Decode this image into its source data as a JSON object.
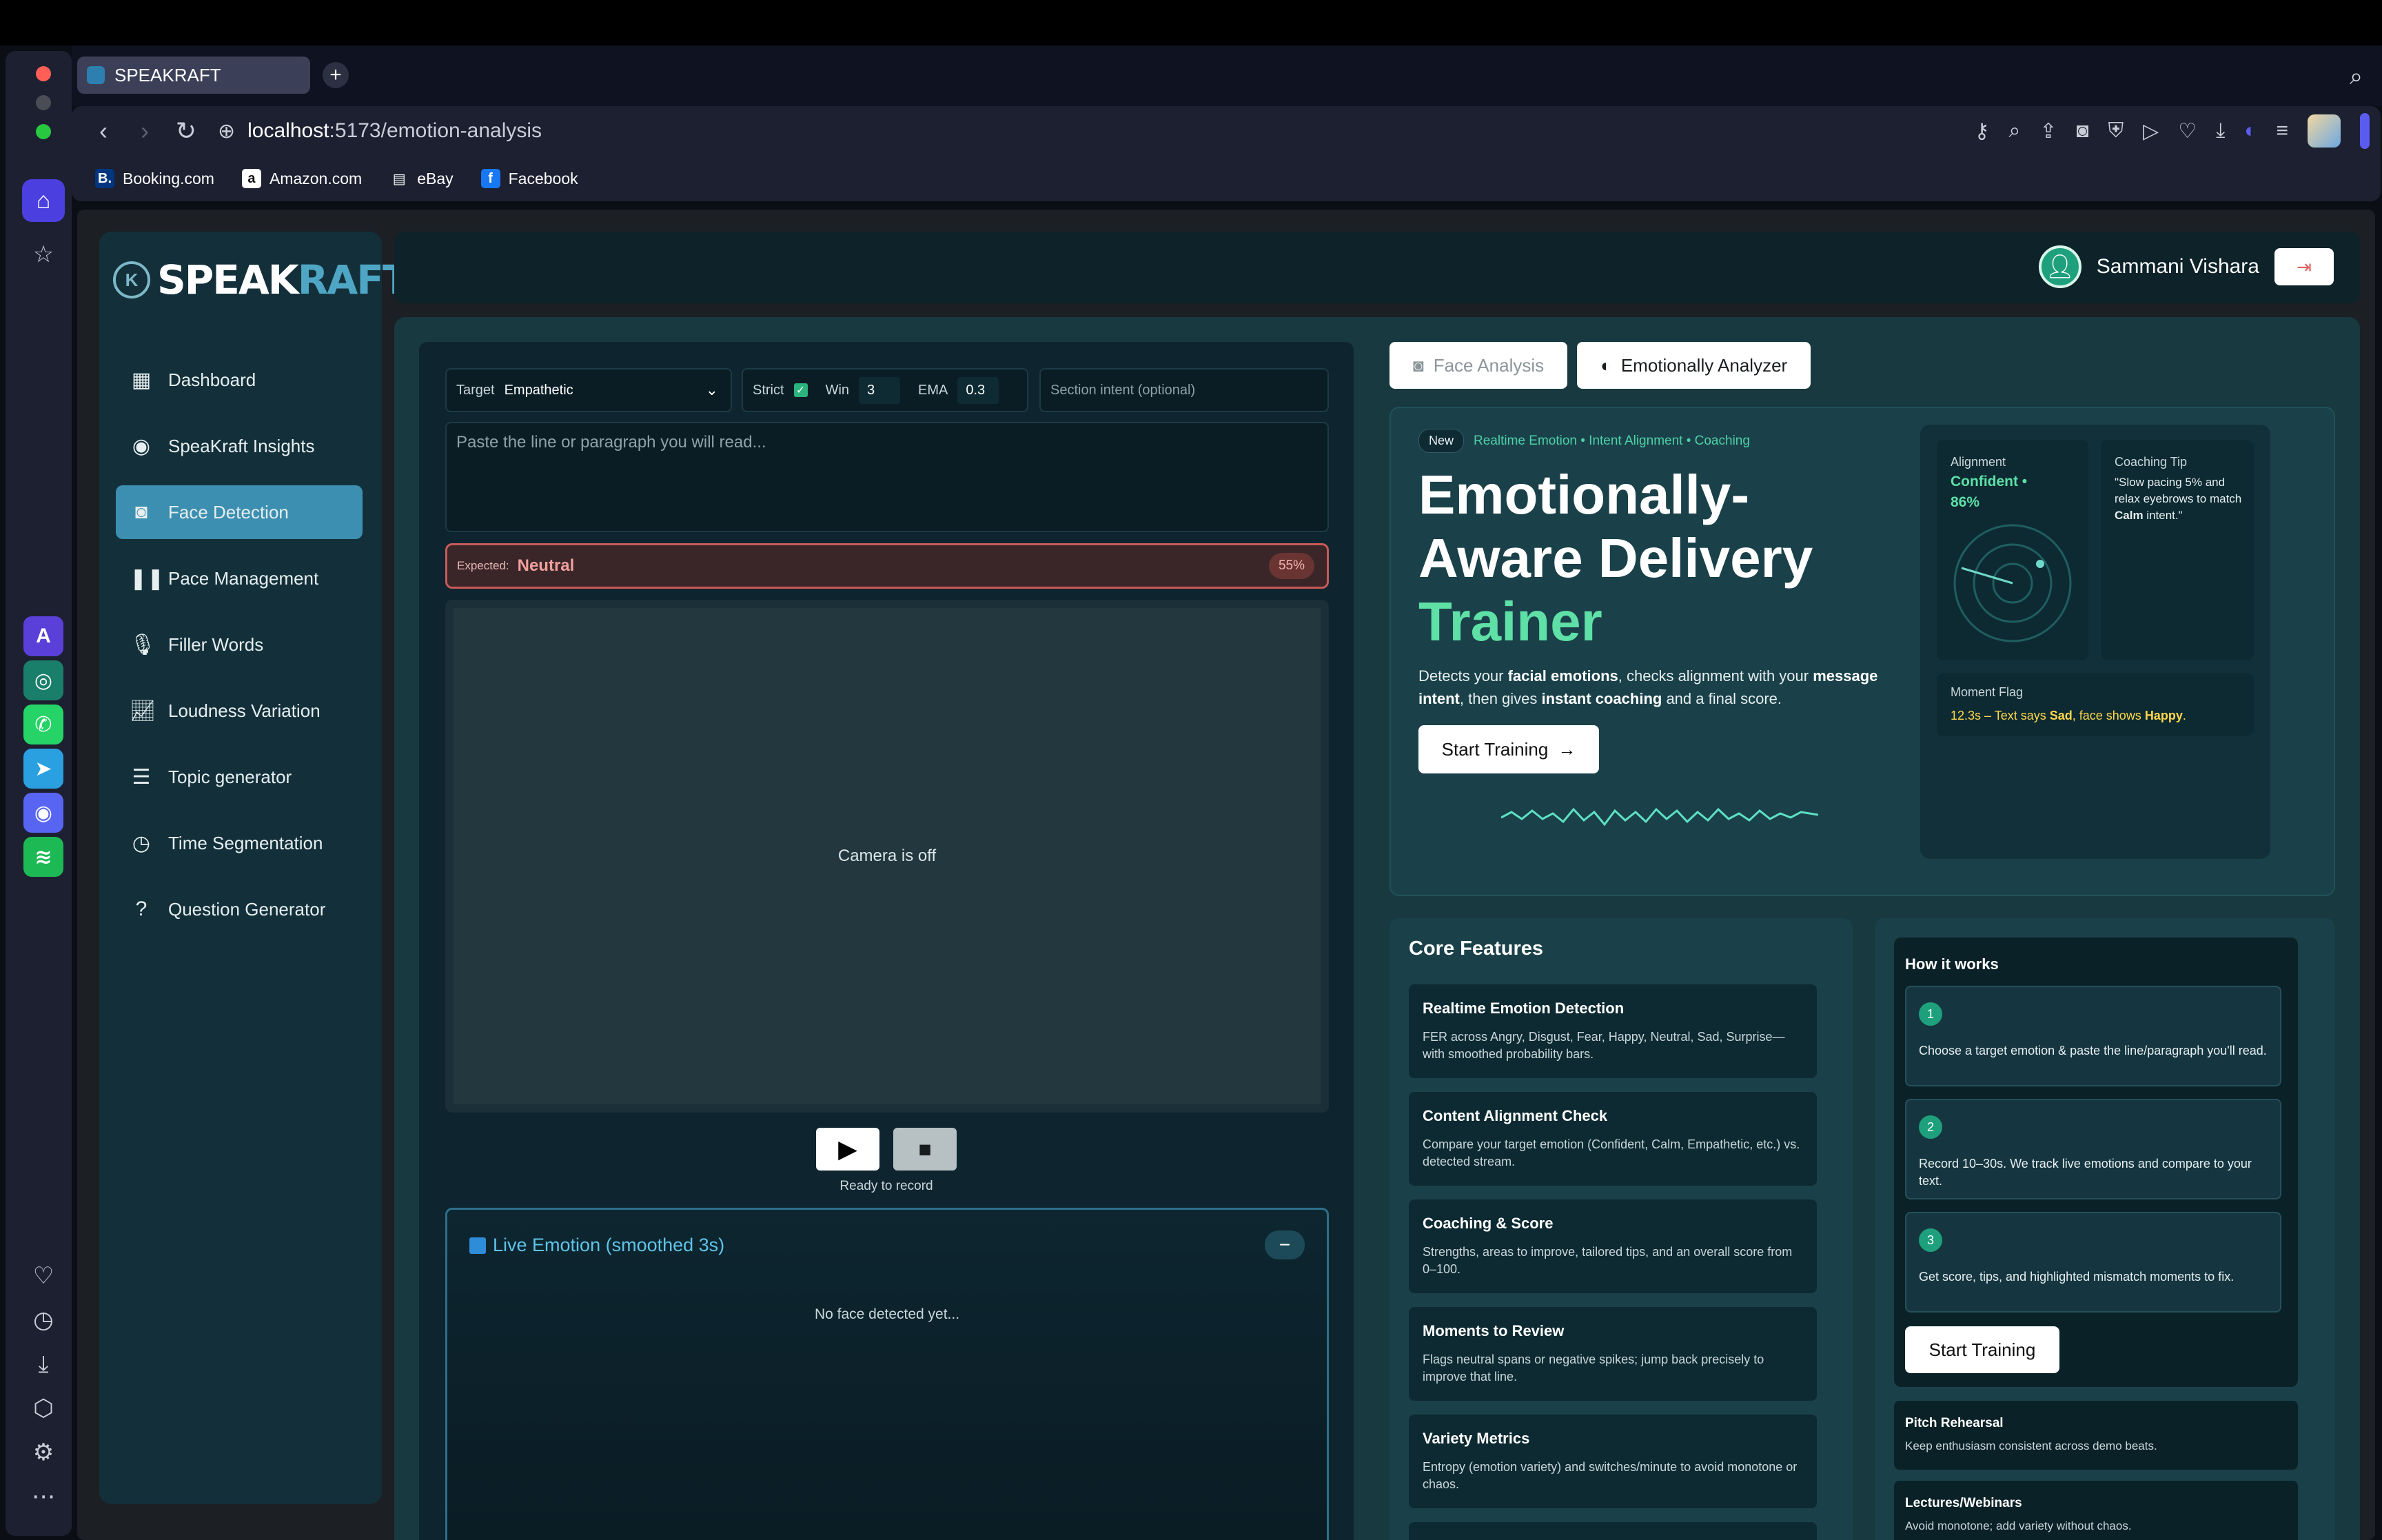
{
  "browser": {
    "tab_title": "SPEAKRAFT",
    "url_host": "localhost",
    "url_path": ":5173/emotion-analysis",
    "bookmarks": [
      {
        "label": "Booking.com",
        "icon": "booking-icon",
        "color": "#003580"
      },
      {
        "label": "Amazon.com",
        "icon": "amazon-icon",
        "color": "#ffffff"
      },
      {
        "label": "eBay",
        "icon": "file-icon",
        "color": "#ffffff"
      },
      {
        "label": "Facebook",
        "icon": "facebook-icon",
        "color": "#1877f2"
      }
    ]
  },
  "brand": {
    "name_a": "SPEAK",
    "name_b": "RAFT"
  },
  "sidebar": {
    "items": [
      {
        "label": "Dashboard",
        "icon": "grid-icon"
      },
      {
        "label": "SpeaKraft Insights",
        "icon": "podcast-icon"
      },
      {
        "label": "Face Detection",
        "icon": "camera-icon",
        "active": true
      },
      {
        "label": "Pace Management",
        "icon": "pause-icon"
      },
      {
        "label": "Filler Words",
        "icon": "mic-icon"
      },
      {
        "label": "Loudness Variation",
        "icon": "chart-line-icon"
      },
      {
        "label": "Topic generator",
        "icon": "list-icon"
      },
      {
        "label": "Time Segmentation",
        "icon": "clock-icon"
      },
      {
        "label": "Question Generator",
        "icon": "question-icon"
      }
    ]
  },
  "header": {
    "user_name": "Sammani Vishara"
  },
  "controls": {
    "target_label": "Target",
    "target_value": "Empathetic",
    "strict_label": "Strict",
    "win_label": "Win",
    "win_value": "3",
    "ema_label": "EMA",
    "ema_value": "0.3",
    "intent_placeholder": "Section intent (optional)",
    "text_placeholder": "Paste the line or paragraph you will read..."
  },
  "expected": {
    "label": "Expected:",
    "value": "Neutral",
    "percent": "55%"
  },
  "camera": {
    "status": "Camera is off",
    "ready": "Ready to record"
  },
  "live": {
    "title": "Live Emotion (smoothed 3s)",
    "empty": "No face detected yet..."
  },
  "tabs": {
    "face": "Face Analysis",
    "emotion": "Emotionally Analyzer"
  },
  "hero": {
    "badge": "New",
    "tagline": "Realtime Emotion • Intent Alignment • Coaching",
    "title_1": "Emotionally-",
    "title_2": "Aware Delivery",
    "title_3": "Trainer",
    "desc_1": "Detects your ",
    "desc_b1": "facial emotions",
    "desc_2": ", checks alignment with your ",
    "desc_b2": "message intent",
    "desc_3": ", then gives ",
    "desc_b3": "instant coaching",
    "desc_4": " and a final score.",
    "cta": "Start Training",
    "alignment_label": "Alignment",
    "alignment_value": "Confident •",
    "alignment_pct": "86%",
    "tip_label": "Coaching Tip",
    "tip_text": "\"Slow pacing 5% and relax eyebrows to match ",
    "tip_bold": "Calm",
    "tip_end": " intent.\"",
    "flag_label": "Moment Flag",
    "flag_1": "12.3s – Text says ",
    "flag_b1": "Sad",
    "flag_2": ", face shows ",
    "flag_b2": "Happy",
    "flag_3": "."
  },
  "features": {
    "heading": "Core Features",
    "items": [
      {
        "title": "Realtime Emotion Detection",
        "desc": "FER across Angry, Disgust, Fear, Happy, Neutral, Sad, Surprise—with smoothed probability bars."
      },
      {
        "title": "Content Alignment Check",
        "desc": "Compare your target emotion (Confident, Calm, Empathetic, etc.) vs. detected stream."
      },
      {
        "title": "Coaching & Score",
        "desc": "Strengths, areas to improve, tailored tips, and an overall score from 0–100."
      },
      {
        "title": "Moments to Review",
        "desc": "Flags neutral spans or negative spikes; jump back precisely to improve that line."
      },
      {
        "title": "Variety Metrics",
        "desc": "Entropy (emotion variety) and switches/minute to avoid monotone or chaos."
      }
    ]
  },
  "how": {
    "heading": "How it works",
    "steps": [
      {
        "n": "1",
        "desc": "Choose a target emotion & paste the line/paragraph you'll read."
      },
      {
        "n": "2",
        "desc": "Record 10–30s. We track live emotions and compare to your text."
      },
      {
        "n": "3",
        "desc": "Get score, tips, and highlighted mismatch moments to fix."
      }
    ],
    "cta": "Start Training",
    "usecases": [
      {
        "title": "Pitch Rehearsal",
        "desc": "Keep enthusiasm consistent across demo beats."
      },
      {
        "title": "Lectures/Webinars",
        "desc": "Avoid monotone; add variety without chaos."
      }
    ]
  }
}
